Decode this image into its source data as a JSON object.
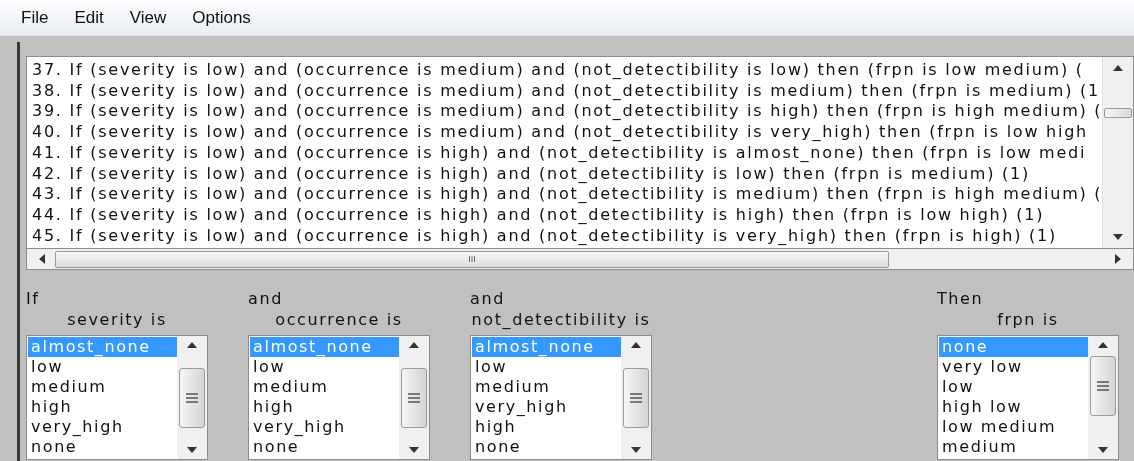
{
  "menu": [
    "File",
    "Edit",
    "View",
    "Options"
  ],
  "rules": [
    "37. If (severity is low) and (occurrence is medium) and (not_detectibility is low) then (frpn is low medium) (",
    "38. If (severity is low) and (occurrence is medium) and (not_detectibility is medium) then (frpn is medium) (1",
    "39. If (severity is low) and (occurrence is medium) and (not_detectibility is high) then (frpn is high medium) (",
    "40. If (severity is low) and (occurrence is medium) and (not_detectibility is very_high) then (frpn is low high",
    "41. If (severity is low) and (occurrence is high) and (not_detectibility is almost_none) then (frpn is low medi",
    "42. If (severity is low) and (occurrence is high) and (not_detectibility is low) then (frpn is medium) (1)",
    "43. If (severity is low) and (occurrence is high) and (not_detectibility is medium) then (frpn is high medium) (",
    "44. If (severity is low) and (occurrence is high) and (not_detectibility is high) then (frpn is low high) (1)",
    "45. If (severity is low) and (occurrence is high) and (not_detectibility is very_high) then (frpn is high) (1)"
  ],
  "horizontal_scroll_label": "III",
  "clauses": [
    {
      "kind": "if",
      "connector": "If",
      "label": "severity is",
      "options": [
        {
          "text": "almost_none",
          "selected": true
        },
        {
          "text": "low",
          "selected": false
        },
        {
          "text": "medium",
          "selected": false
        },
        {
          "text": "high",
          "selected": false
        },
        {
          "text": "very_high",
          "selected": false
        },
        {
          "text": "none",
          "selected": false
        }
      ]
    },
    {
      "kind": "if",
      "connector": "and",
      "label": "occurrence is",
      "options": [
        {
          "text": "almost_none",
          "selected": true
        },
        {
          "text": "low",
          "selected": false
        },
        {
          "text": "medium",
          "selected": false
        },
        {
          "text": "high",
          "selected": false
        },
        {
          "text": "very_high",
          "selected": false
        },
        {
          "text": "none",
          "selected": false
        }
      ]
    },
    {
      "kind": "if",
      "connector": "and",
      "label": "not_detectibility is",
      "options": [
        {
          "text": "almost_none",
          "selected": true
        },
        {
          "text": "low",
          "selected": false
        },
        {
          "text": "medium",
          "selected": false
        },
        {
          "text": "very_high",
          "selected": false
        },
        {
          "text": "high",
          "selected": false
        },
        {
          "text": "none",
          "selected": false
        }
      ]
    },
    {
      "kind": "then",
      "connector": "Then",
      "label": "frpn is",
      "options": [
        {
          "text": "none",
          "selected": true
        },
        {
          "text": "very low",
          "selected": false
        },
        {
          "text": "low",
          "selected": false
        },
        {
          "text": "high low",
          "selected": false
        },
        {
          "text": "low medium",
          "selected": false
        },
        {
          "text": "medium",
          "selected": false
        }
      ]
    }
  ]
}
